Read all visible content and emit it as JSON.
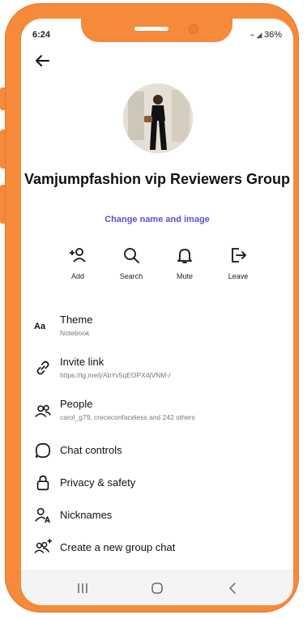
{
  "status_bar": {
    "time": "6:24",
    "battery": "36%"
  },
  "header": {
    "back_icon": "back-arrow-icon"
  },
  "group": {
    "name": "Vamjumpfashion vip Reviewers Group",
    "change_link": "Change name and image"
  },
  "actions": [
    {
      "label": "Add",
      "icon": "add-person-icon"
    },
    {
      "label": "Search",
      "icon": "search-icon"
    },
    {
      "label": "Mute",
      "icon": "bell-icon"
    },
    {
      "label": "Leave",
      "icon": "leave-icon"
    }
  ],
  "menu": [
    {
      "title": "Theme",
      "subtitle": "Notebook",
      "icon": "theme-icon"
    },
    {
      "title": "Invite link",
      "subtitle": "https://ig.me/j/AbYv5qEOPX4jVNM-/",
      "icon": "link-icon"
    },
    {
      "title": "People",
      "subtitle": "carol_g79, crececonfaceless and 242 others",
      "icon": "people-icon"
    },
    {
      "title": "Chat controls",
      "icon": "chat-bubble-icon"
    },
    {
      "title": "Privacy & safety",
      "icon": "lock-icon"
    },
    {
      "title": "Nicknames",
      "icon": "nickname-icon"
    },
    {
      "title": "Create a new group chat",
      "icon": "group-add-icon"
    }
  ],
  "nav_bar": {
    "recents_icon": "recents-icon",
    "home_icon": "home-icon",
    "back_icon": "nav-back-icon"
  },
  "colors": {
    "frame": "#f58a3b",
    "link": "#5b51d8"
  }
}
